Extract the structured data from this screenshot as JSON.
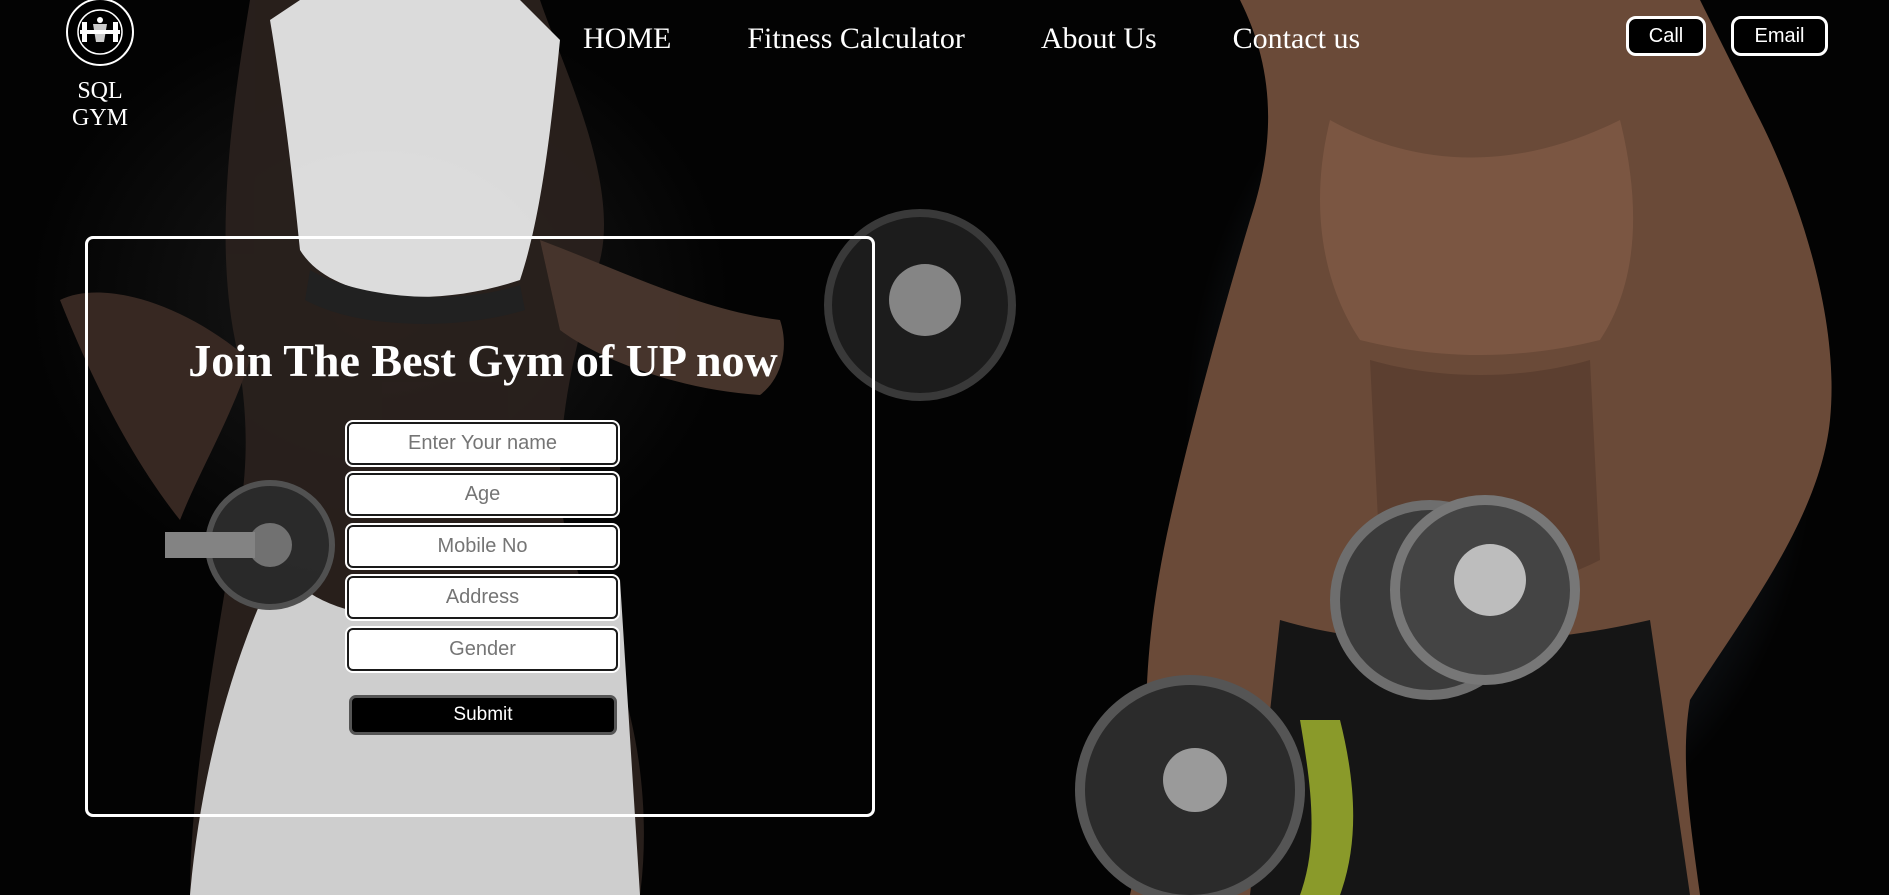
{
  "brand": {
    "name": "SQL GYM",
    "logo_icon": "dumbbell-badge-icon",
    "logo_ring_text": "POWER HOUSE GYM CENTER"
  },
  "nav": {
    "items": [
      {
        "label": "HOME"
      },
      {
        "label": "Fitness Calculator"
      },
      {
        "label": "About Us"
      },
      {
        "label": "Contact us"
      }
    ]
  },
  "actions": {
    "call_label": "Call",
    "email_label": "Email"
  },
  "form": {
    "title": "Join The Best Gym of UP now",
    "fields": {
      "name_placeholder": "Enter Your name",
      "age_placeholder": "Age",
      "mobile_placeholder": "Mobile No",
      "address_placeholder": "Address",
      "gender_placeholder": "Gender"
    },
    "submit_label": "Submit"
  },
  "colors": {
    "background": "#030303",
    "text": "#ffffff",
    "button_bg": "#000000",
    "input_bg": "#ffffff"
  }
}
